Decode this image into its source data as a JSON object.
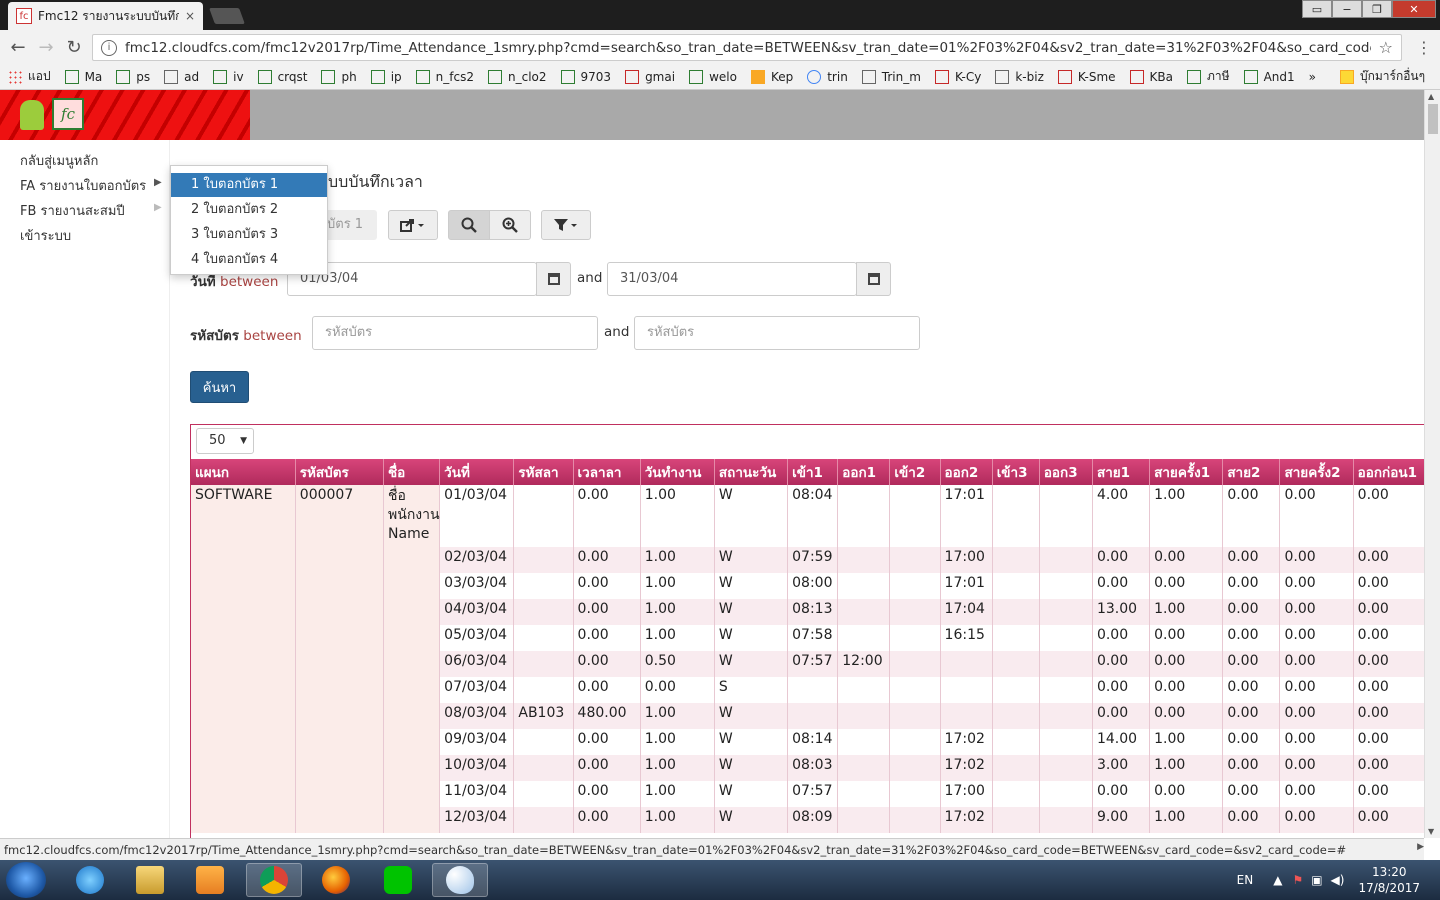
{
  "browser": {
    "tab_title": "Fmc12 รายงานระบบบันทึกเ",
    "tab_close": "×",
    "url": "fmc12.cloudfcs.com/fmc12v2017rp/Time_Attendance_1smry.php?cmd=search&so_tran_date=BETWEEN&sv_tran_date=01%2F03%2F04&sv2_tran_date=31%2F03%2F04&so_card_code=BETWEEN&sv_ca...",
    "window_controls": [
      "▭",
      "−",
      "❐",
      "✕"
    ],
    "nav": {
      "back": "←",
      "forward": "→",
      "reload": "↻",
      "star": "☆",
      "menu": "⋮",
      "info": "i"
    },
    "bookmarks": [
      {
        "label": "แอป",
        "icon": "apps-icon"
      },
      {
        "label": "Ma",
        "icon": "sheet-icon"
      },
      {
        "label": "ps",
        "icon": "sheet-icon"
      },
      {
        "label": "ad",
        "icon": "doc-icon"
      },
      {
        "label": "iv",
        "icon": "sheet-icon"
      },
      {
        "label": "crqst",
        "icon": "sheet-icon"
      },
      {
        "label": "ph",
        "icon": "sheet-icon"
      },
      {
        "label": "ip",
        "icon": "sheet-icon"
      },
      {
        "label": "n_fcs2",
        "icon": "fc-icon"
      },
      {
        "label": "n_clo2",
        "icon": "fc-icon"
      },
      {
        "label": "9703",
        "icon": "fc-icon"
      },
      {
        "label": "gmai",
        "icon": "gmail-icon"
      },
      {
        "label": "welo",
        "icon": "bag-icon"
      },
      {
        "label": "Kep",
        "icon": "bulb-icon"
      },
      {
        "label": "trin",
        "icon": "google-icon"
      },
      {
        "label": "Trin_m",
        "icon": "doc-icon"
      },
      {
        "label": "K-Cy",
        "icon": "k-icon"
      },
      {
        "label": "k-biz",
        "icon": "doc-icon"
      },
      {
        "label": "K-Sme",
        "icon": "k-icon"
      },
      {
        "label": "KBa",
        "icon": "k-icon"
      },
      {
        "label": "ภาษี",
        "icon": "tax-icon"
      },
      {
        "label": "And1",
        "icon": "android-icon"
      }
    ],
    "bookmarks_more": "»",
    "bookmarks_folder": "บุ๊กมาร์กอื่นๆ",
    "status_url": "fmc12.cloudfcs.com/fmc12v2017rp/Time_Attendance_1smry.php?cmd=search&so_tran_date=BETWEEN&sv_tran_date=01%2F03%2F04&sv2_tran_date=31%2F03%2F04&so_card_code=BETWEEN&sv_card_code=&sv2_card_code=#"
  },
  "app": {
    "logo_text": "fc",
    "sidebar": [
      {
        "label": "กลับสู่เมนูหลัก"
      },
      {
        "label": "FA รายงานใบตอกบัตร"
      },
      {
        "label": "FB รายงานสะสมปี"
      },
      {
        "label": "เข้าระบบ"
      }
    ],
    "submenu": [
      {
        "label": "1 ใบตอกบัตร 1"
      },
      {
        "label": "2 ใบตอกบัตร 2"
      },
      {
        "label": "3 ใบตอกบัตร 3"
      },
      {
        "label": "4 ใบตอกบัตร 4"
      }
    ],
    "page_title_fragment": "บบบันทึกเวลา",
    "tab_fragment": "บัตร 1",
    "filters": {
      "date_label": "วันที่",
      "between": "between",
      "and": "and",
      "date_from": "01/03/04",
      "date_to": "31/03/04",
      "card_label": "รหัสบัตร",
      "card_placeholder": "รหัสบัตร",
      "search_button": "ค้นหา"
    },
    "page_size": "50",
    "columns": [
      "แผนก",
      "รหัสบัตร",
      "ชื่อ",
      "วันที่",
      "รหัสลา",
      "เวลาลา",
      "วันทำงาน",
      "สถานะวัน",
      "เข้า1",
      "ออก1",
      "เข้า2",
      "ออก2",
      "เข้า3",
      "ออก3",
      "สาย1",
      "สายครั้ง1",
      "สาย2",
      "สายครั้ง2",
      "ออกก่อน1"
    ],
    "rows": [
      [
        "SOFTWARE",
        "000007",
        "ชื่อ พนักงาน Name",
        "01/03/04",
        "",
        "0.00",
        "1.00",
        "W",
        "08:04",
        "",
        "",
        "17:01",
        "",
        "",
        "4.00",
        "1.00",
        "0.00",
        "0.00",
        "0.00"
      ],
      [
        "",
        "",
        "",
        "02/03/04",
        "",
        "0.00",
        "1.00",
        "W",
        "07:59",
        "",
        "",
        "17:00",
        "",
        "",
        "0.00",
        "0.00",
        "0.00",
        "0.00",
        "0.00"
      ],
      [
        "",
        "",
        "",
        "03/03/04",
        "",
        "0.00",
        "1.00",
        "W",
        "08:00",
        "",
        "",
        "17:01",
        "",
        "",
        "0.00",
        "0.00",
        "0.00",
        "0.00",
        "0.00"
      ],
      [
        "",
        "",
        "",
        "04/03/04",
        "",
        "0.00",
        "1.00",
        "W",
        "08:13",
        "",
        "",
        "17:04",
        "",
        "",
        "13.00",
        "1.00",
        "0.00",
        "0.00",
        "0.00"
      ],
      [
        "",
        "",
        "",
        "05/03/04",
        "",
        "0.00",
        "1.00",
        "W",
        "07:58",
        "",
        "",
        "16:15",
        "",
        "",
        "0.00",
        "0.00",
        "0.00",
        "0.00",
        "0.00"
      ],
      [
        "",
        "",
        "",
        "06/03/04",
        "",
        "0.00",
        "0.50",
        "W",
        "07:57",
        "12:00",
        "",
        "",
        "",
        "",
        "0.00",
        "0.00",
        "0.00",
        "0.00",
        "0.00"
      ],
      [
        "",
        "",
        "",
        "07/03/04",
        "",
        "0.00",
        "0.00",
        "S",
        "",
        "",
        "",
        "",
        "",
        "",
        "0.00",
        "0.00",
        "0.00",
        "0.00",
        "0.00"
      ],
      [
        "",
        "",
        "",
        "08/03/04",
        "AB103",
        "480.00",
        "1.00",
        "W",
        "",
        "",
        "",
        "",
        "",
        "",
        "0.00",
        "0.00",
        "0.00",
        "0.00",
        "0.00"
      ],
      [
        "",
        "",
        "",
        "09/03/04",
        "",
        "0.00",
        "1.00",
        "W",
        "08:14",
        "",
        "",
        "17:02",
        "",
        "",
        "14.00",
        "1.00",
        "0.00",
        "0.00",
        "0.00"
      ],
      [
        "",
        "",
        "",
        "10/03/04",
        "",
        "0.00",
        "1.00",
        "W",
        "08:03",
        "",
        "",
        "17:02",
        "",
        "",
        "3.00",
        "1.00",
        "0.00",
        "0.00",
        "0.00"
      ],
      [
        "",
        "",
        "",
        "11/03/04",
        "",
        "0.00",
        "1.00",
        "W",
        "07:57",
        "",
        "",
        "17:00",
        "",
        "",
        "0.00",
        "0.00",
        "0.00",
        "0.00",
        "0.00"
      ],
      [
        "",
        "",
        "",
        "12/03/04",
        "",
        "0.00",
        "1.00",
        "W",
        "08:09",
        "",
        "",
        "17:02",
        "",
        "",
        "9.00",
        "1.00",
        "0.00",
        "0.00",
        "0.00"
      ]
    ]
  },
  "taskbar": {
    "lang": "EN",
    "time": "13:20",
    "date": "17/8/2017"
  }
}
